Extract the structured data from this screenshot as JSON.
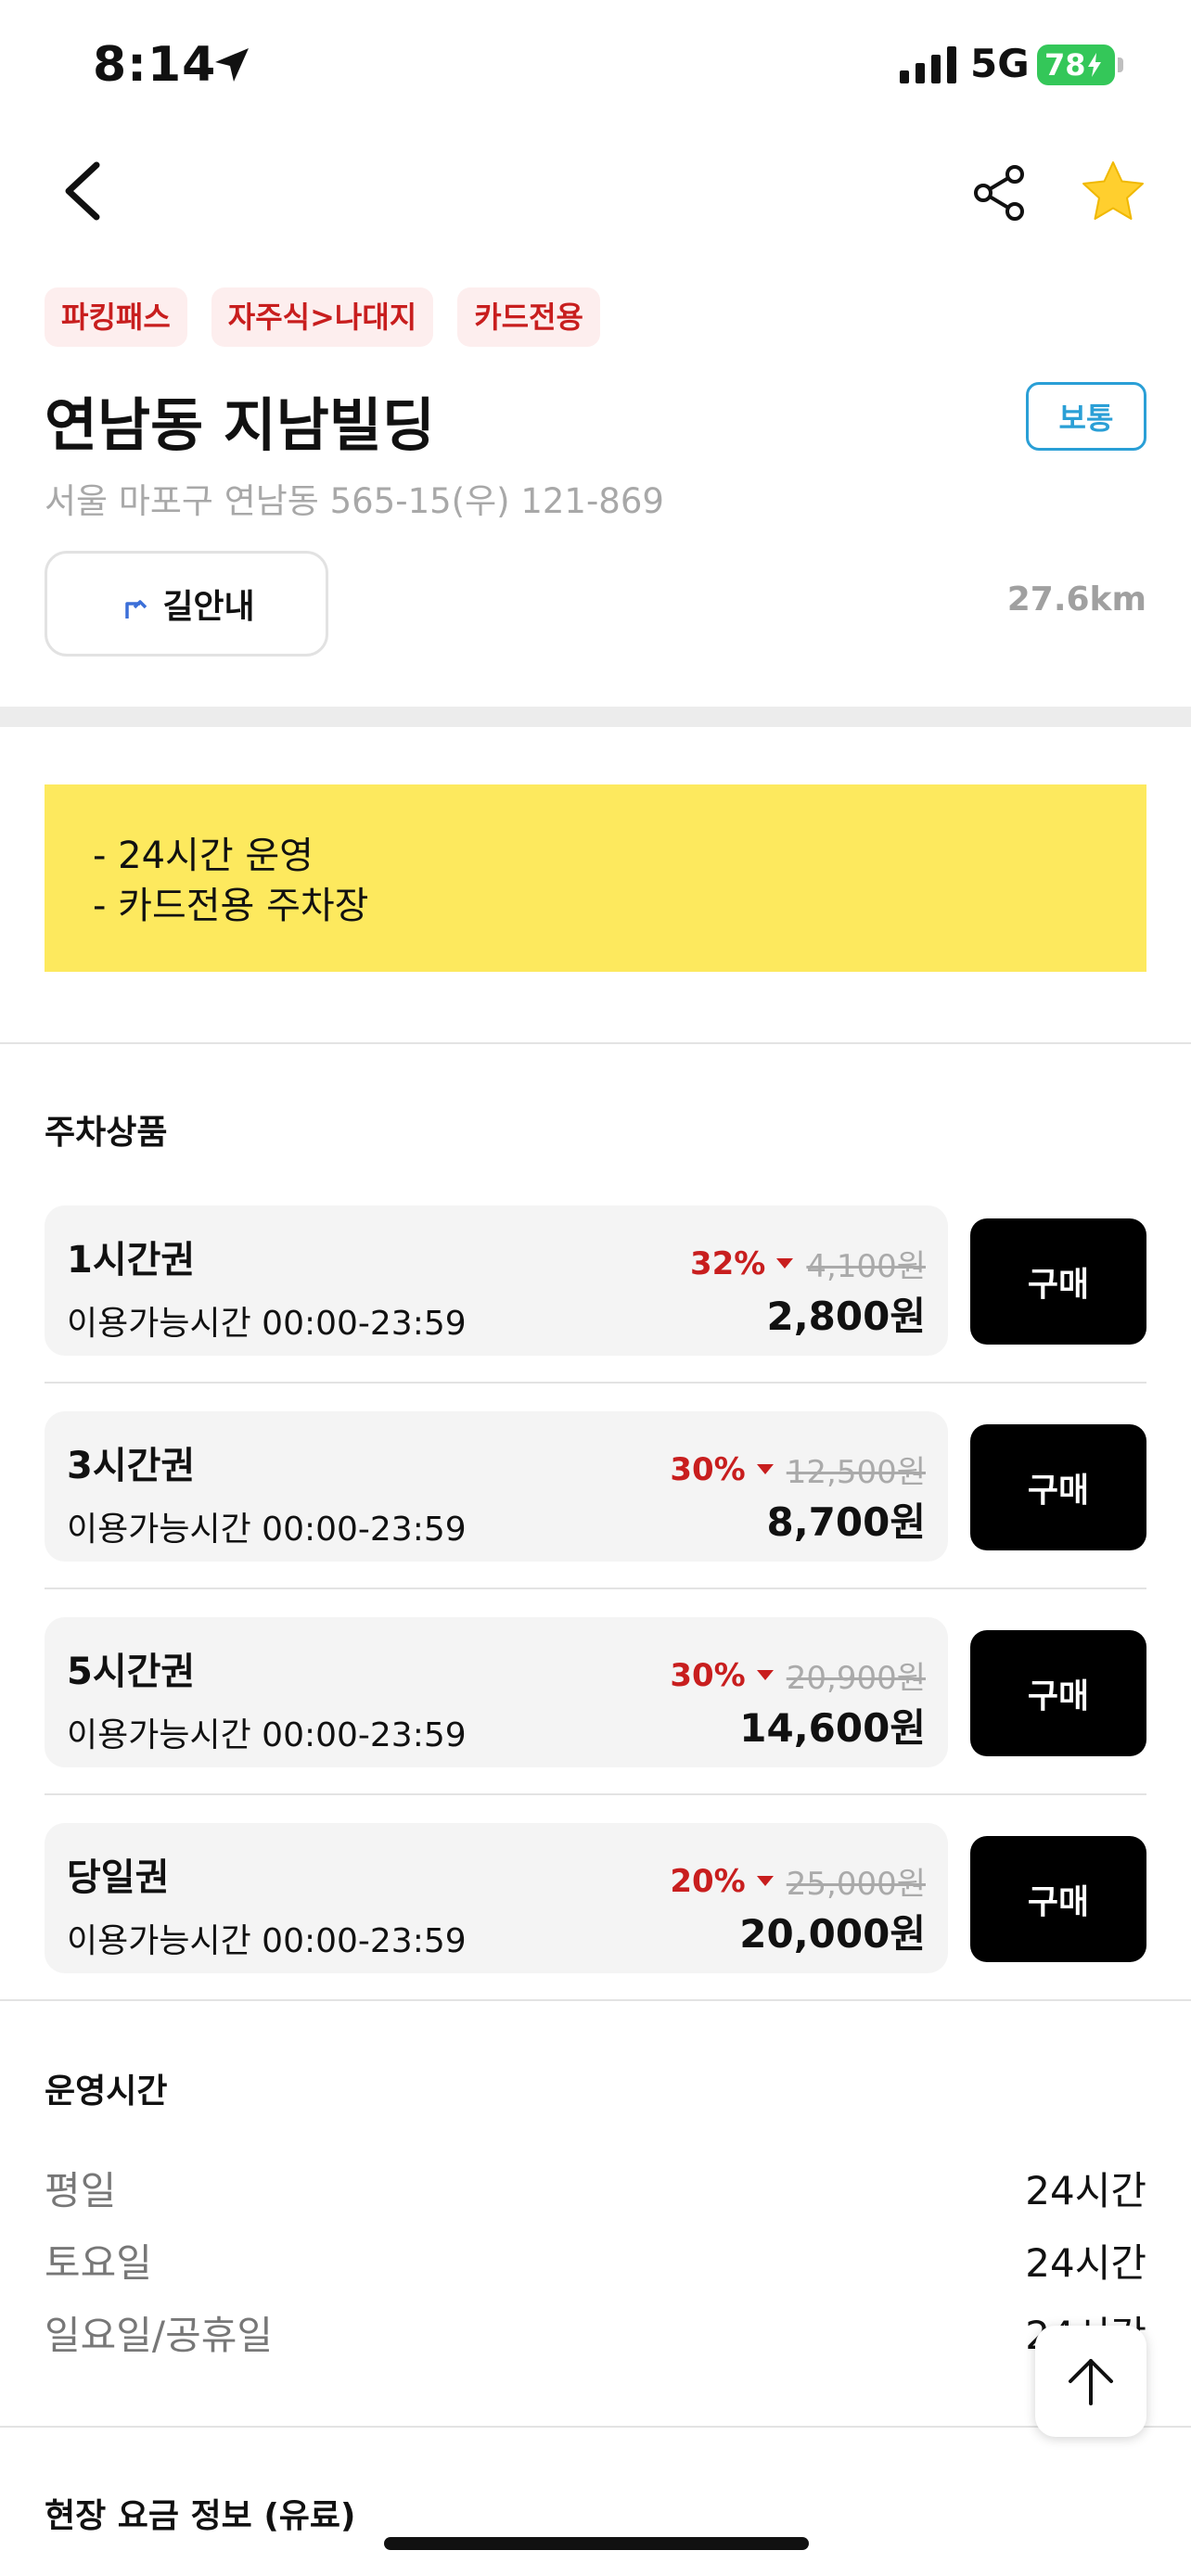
{
  "status_bar": {
    "time": "8:14",
    "network": "5G",
    "battery": "78"
  },
  "icons": {
    "back": "chevron-left-icon",
    "share": "share-icon",
    "favorite": "star-icon",
    "directions": "turn-arrow-icon",
    "scroll_top": "arrow-up-icon"
  },
  "colors": {
    "tag_text": "#c81e1e",
    "tag_bg": "#fdeeee",
    "badge": "#2a9fd6",
    "notice_bg": "#fde95e",
    "buy_button": "#000000",
    "favorite_star": "#ffcf2e",
    "battery": "#34c759"
  },
  "tags": [
    "파킹패스",
    "자주식>나대지",
    "카드전용"
  ],
  "place": {
    "name": "연남동 지남빌딩",
    "badge": "보통",
    "address": "서울 마포구 연남동 565-15(우) 121-869",
    "directions_label": "길안내",
    "distance": "27.6km"
  },
  "notice": {
    "lines": [
      "- 24시간 운영",
      "- 카드전용 주차장"
    ]
  },
  "products": {
    "title": "주차상품",
    "buy_label": "구매",
    "items": [
      {
        "name": "1시간권",
        "time": "이용가능시간 00:00-23:59",
        "discount": "32%",
        "original": "4,100원",
        "price": "2,800원"
      },
      {
        "name": "3시간권",
        "time": "이용가능시간 00:00-23:59",
        "discount": "30%",
        "original": "12,500원",
        "price": "8,700원"
      },
      {
        "name": "5시간권",
        "time": "이용가능시간 00:00-23:59",
        "discount": "30%",
        "original": "20,900원",
        "price": "14,600원"
      },
      {
        "name": "당일권",
        "time": "이용가능시간 00:00-23:59",
        "discount": "20%",
        "original": "25,000원",
        "price": "20,000원"
      }
    ]
  },
  "hours": {
    "title": "운영시간",
    "rows": [
      {
        "day": "평일",
        "value": "24시간"
      },
      {
        "day": "토요일",
        "value": "24시간"
      },
      {
        "day": "일요일/공휴일",
        "value": "24시간"
      }
    ]
  },
  "onsite_fee": {
    "title": "현장 요금 정보 (유료)"
  }
}
